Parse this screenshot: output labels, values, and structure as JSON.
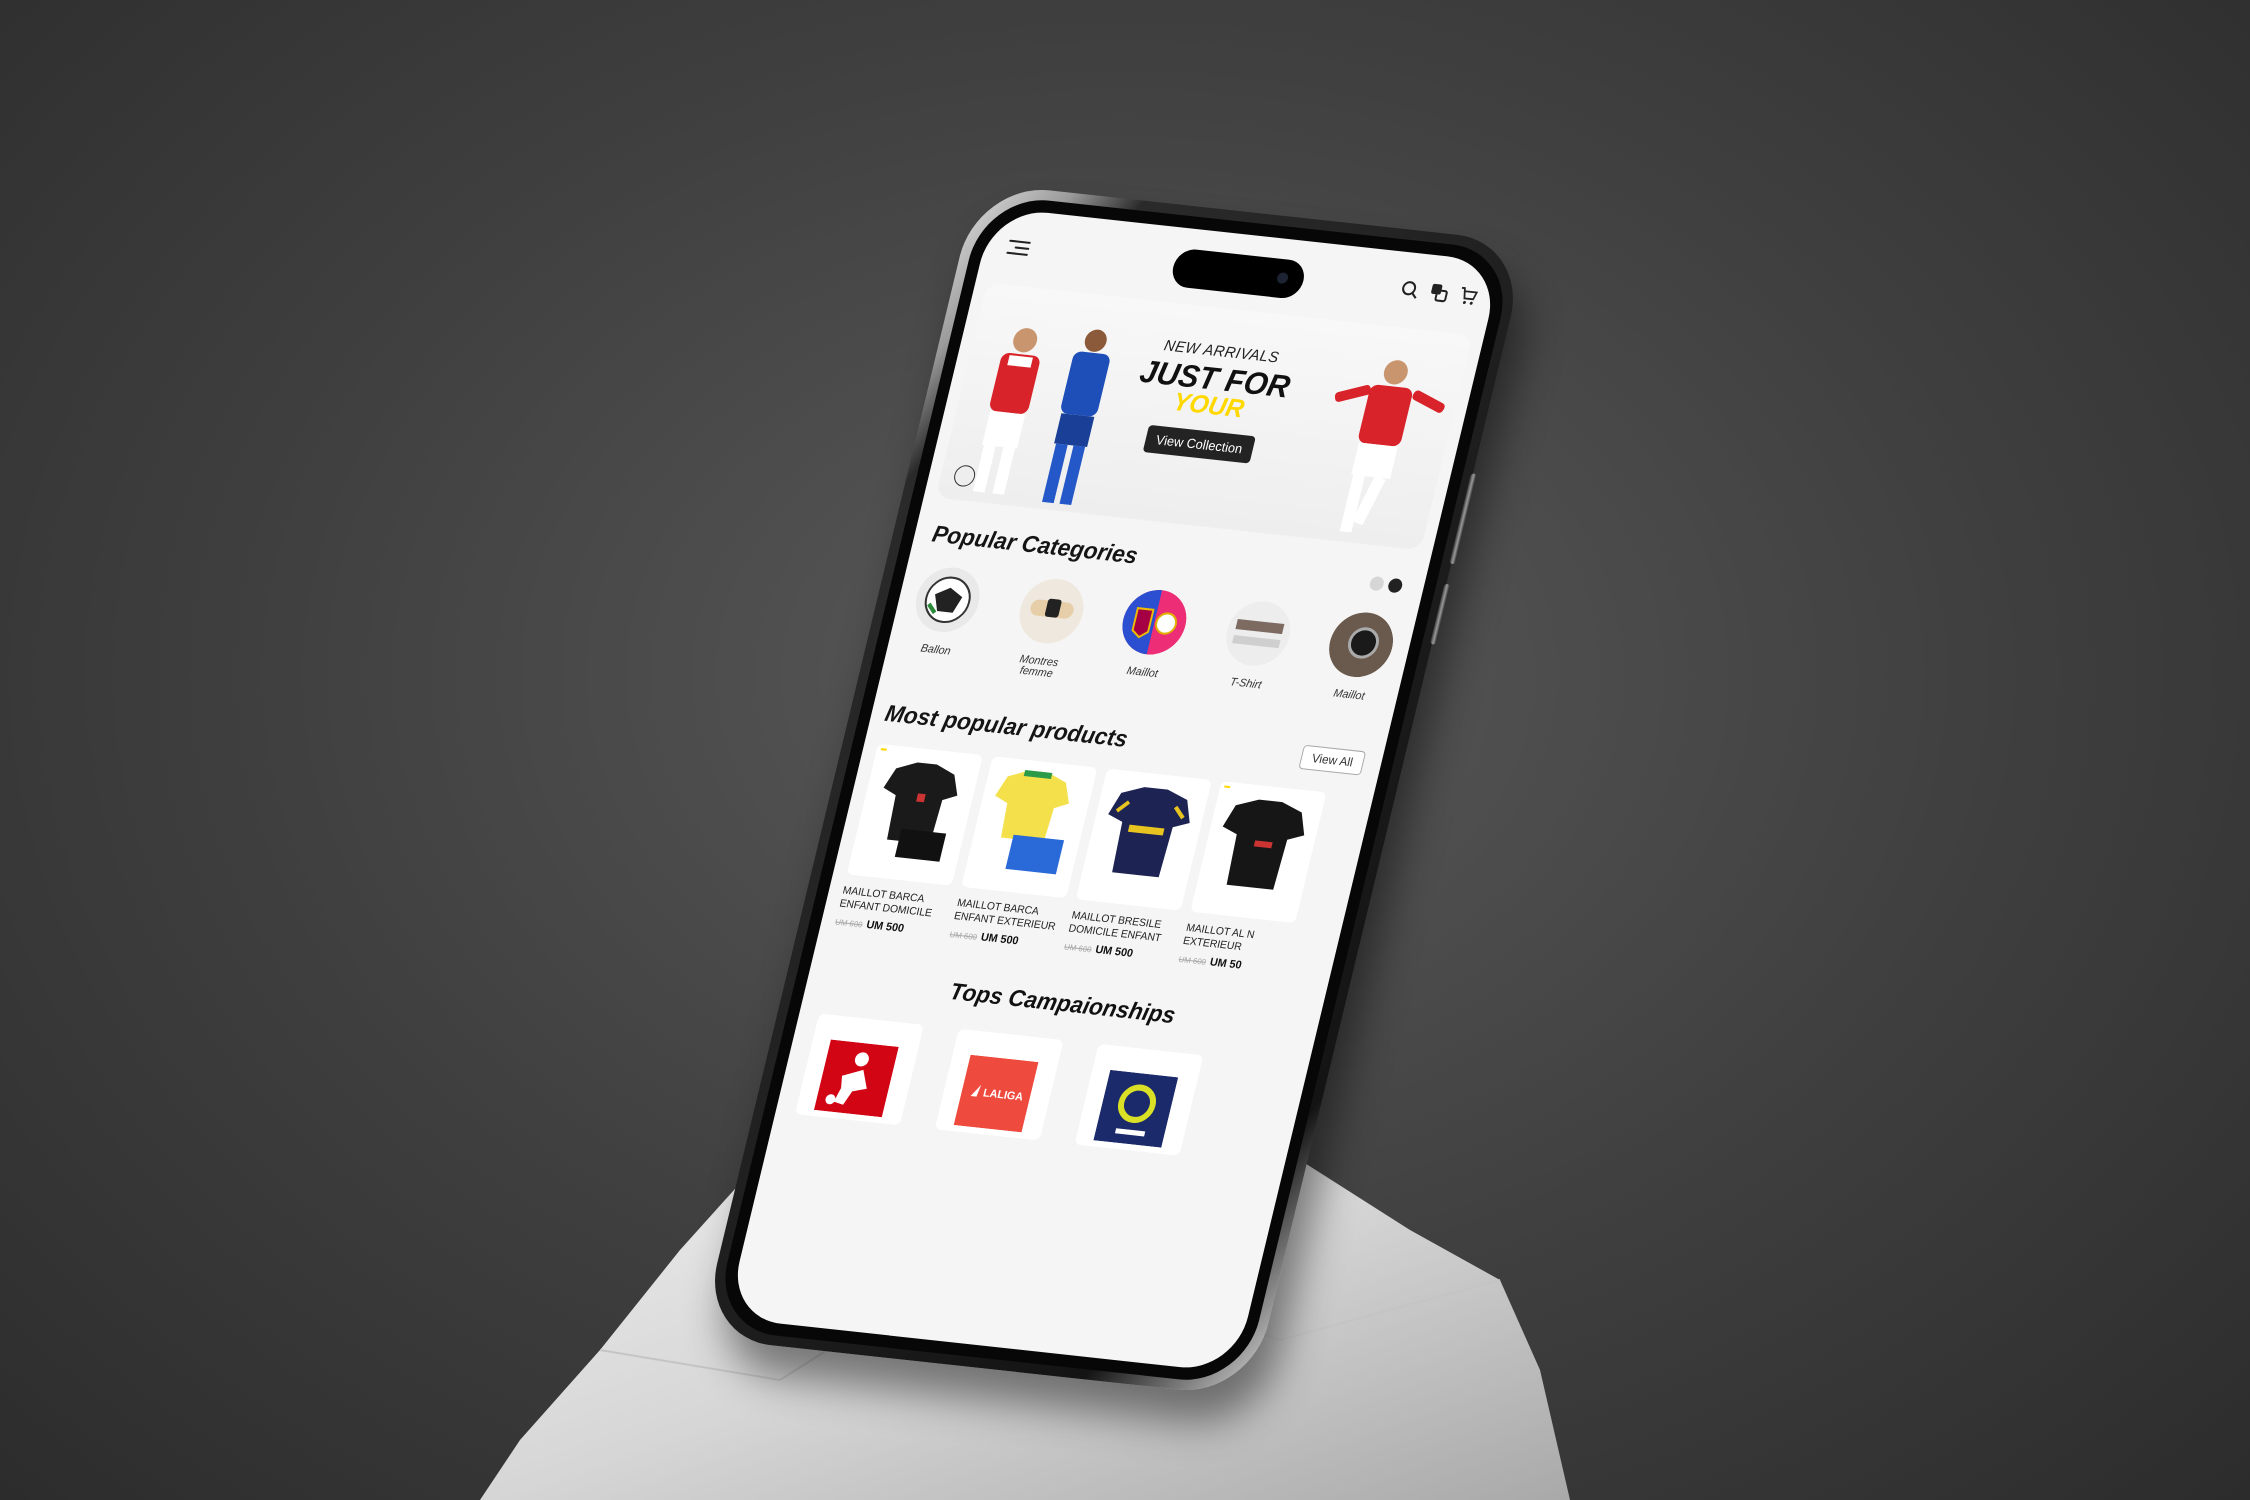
{
  "app": {
    "hero": {
      "subtitle": "NEW ARRIVALS",
      "title_line1": "JUST FOR",
      "title_line2": "YOUR",
      "button_label": "View Collection"
    },
    "categories": {
      "title": "Popular Categories",
      "items": [
        {
          "label": "Ballon"
        },
        {
          "label": "Montres femme"
        },
        {
          "label": "Maillot"
        },
        {
          "label": "T-Shirt"
        },
        {
          "label": "Maillot"
        }
      ]
    },
    "products": {
      "title": "Most popular products",
      "view_all_label": "View All",
      "items": [
        {
          "name": "MAILLOT BARCA ENFANT DOMICILE",
          "old_price": "UM 600",
          "price": "UM 500"
        },
        {
          "name": "MAILLOT BARCA ENFANT EXTERIEUR",
          "old_price": "UM 600",
          "price": "UM 500"
        },
        {
          "name": "MAILLOT BRESILE DOMICILE ENFANT",
          "old_price": "UM 600",
          "price": "UM 500"
        },
        {
          "name": "MAILLOT AL N EXTERIEUR",
          "old_price": "UM 600",
          "price": "UM 50"
        }
      ]
    },
    "championships": {
      "title": "Tops Campaionships",
      "items": [
        {
          "name": "Bundesliga"
        },
        {
          "name": "LALIGA"
        },
        {
          "name": "Ligue 1"
        }
      ]
    },
    "colors": {
      "accent_yellow": "#ffd800",
      "dark": "#232323"
    }
  }
}
